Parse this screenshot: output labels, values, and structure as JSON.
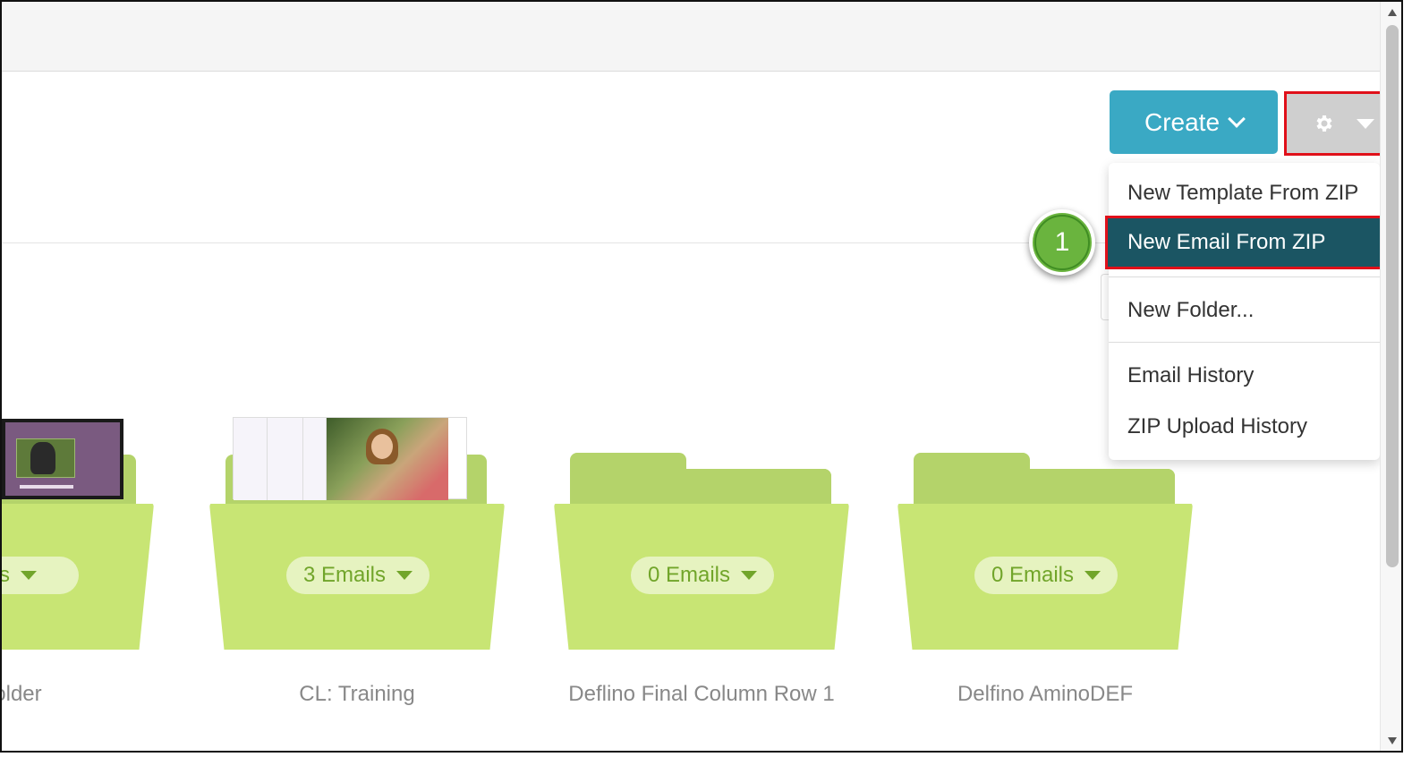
{
  "toolbar": {
    "create_label": "Create",
    "settings_icon": "gear-icon"
  },
  "menu": {
    "items": [
      {
        "label": "New Template From ZIP"
      },
      {
        "label": "New Email From ZIP",
        "highlighted": true
      },
      {
        "label": "New Folder..."
      },
      {
        "label": "Email History"
      },
      {
        "label": "ZIP Upload History"
      }
    ]
  },
  "callout": {
    "number": "1"
  },
  "folders": [
    {
      "name": "'s Folder",
      "count": "ails"
    },
    {
      "name": "CL: Training",
      "count": "3 Emails"
    },
    {
      "name": "Deflino Final Column Row 1",
      "count": "0 Emails"
    },
    {
      "name": "Delfino AminoDEF",
      "count": "0 Emails"
    }
  ],
  "colors": {
    "create_button": "#3aa9c4",
    "menu_highlight": "#1b5563",
    "annotation_border": "#e0101a",
    "folder_green": "#c8e574",
    "callout_green": "#6ab43e"
  }
}
